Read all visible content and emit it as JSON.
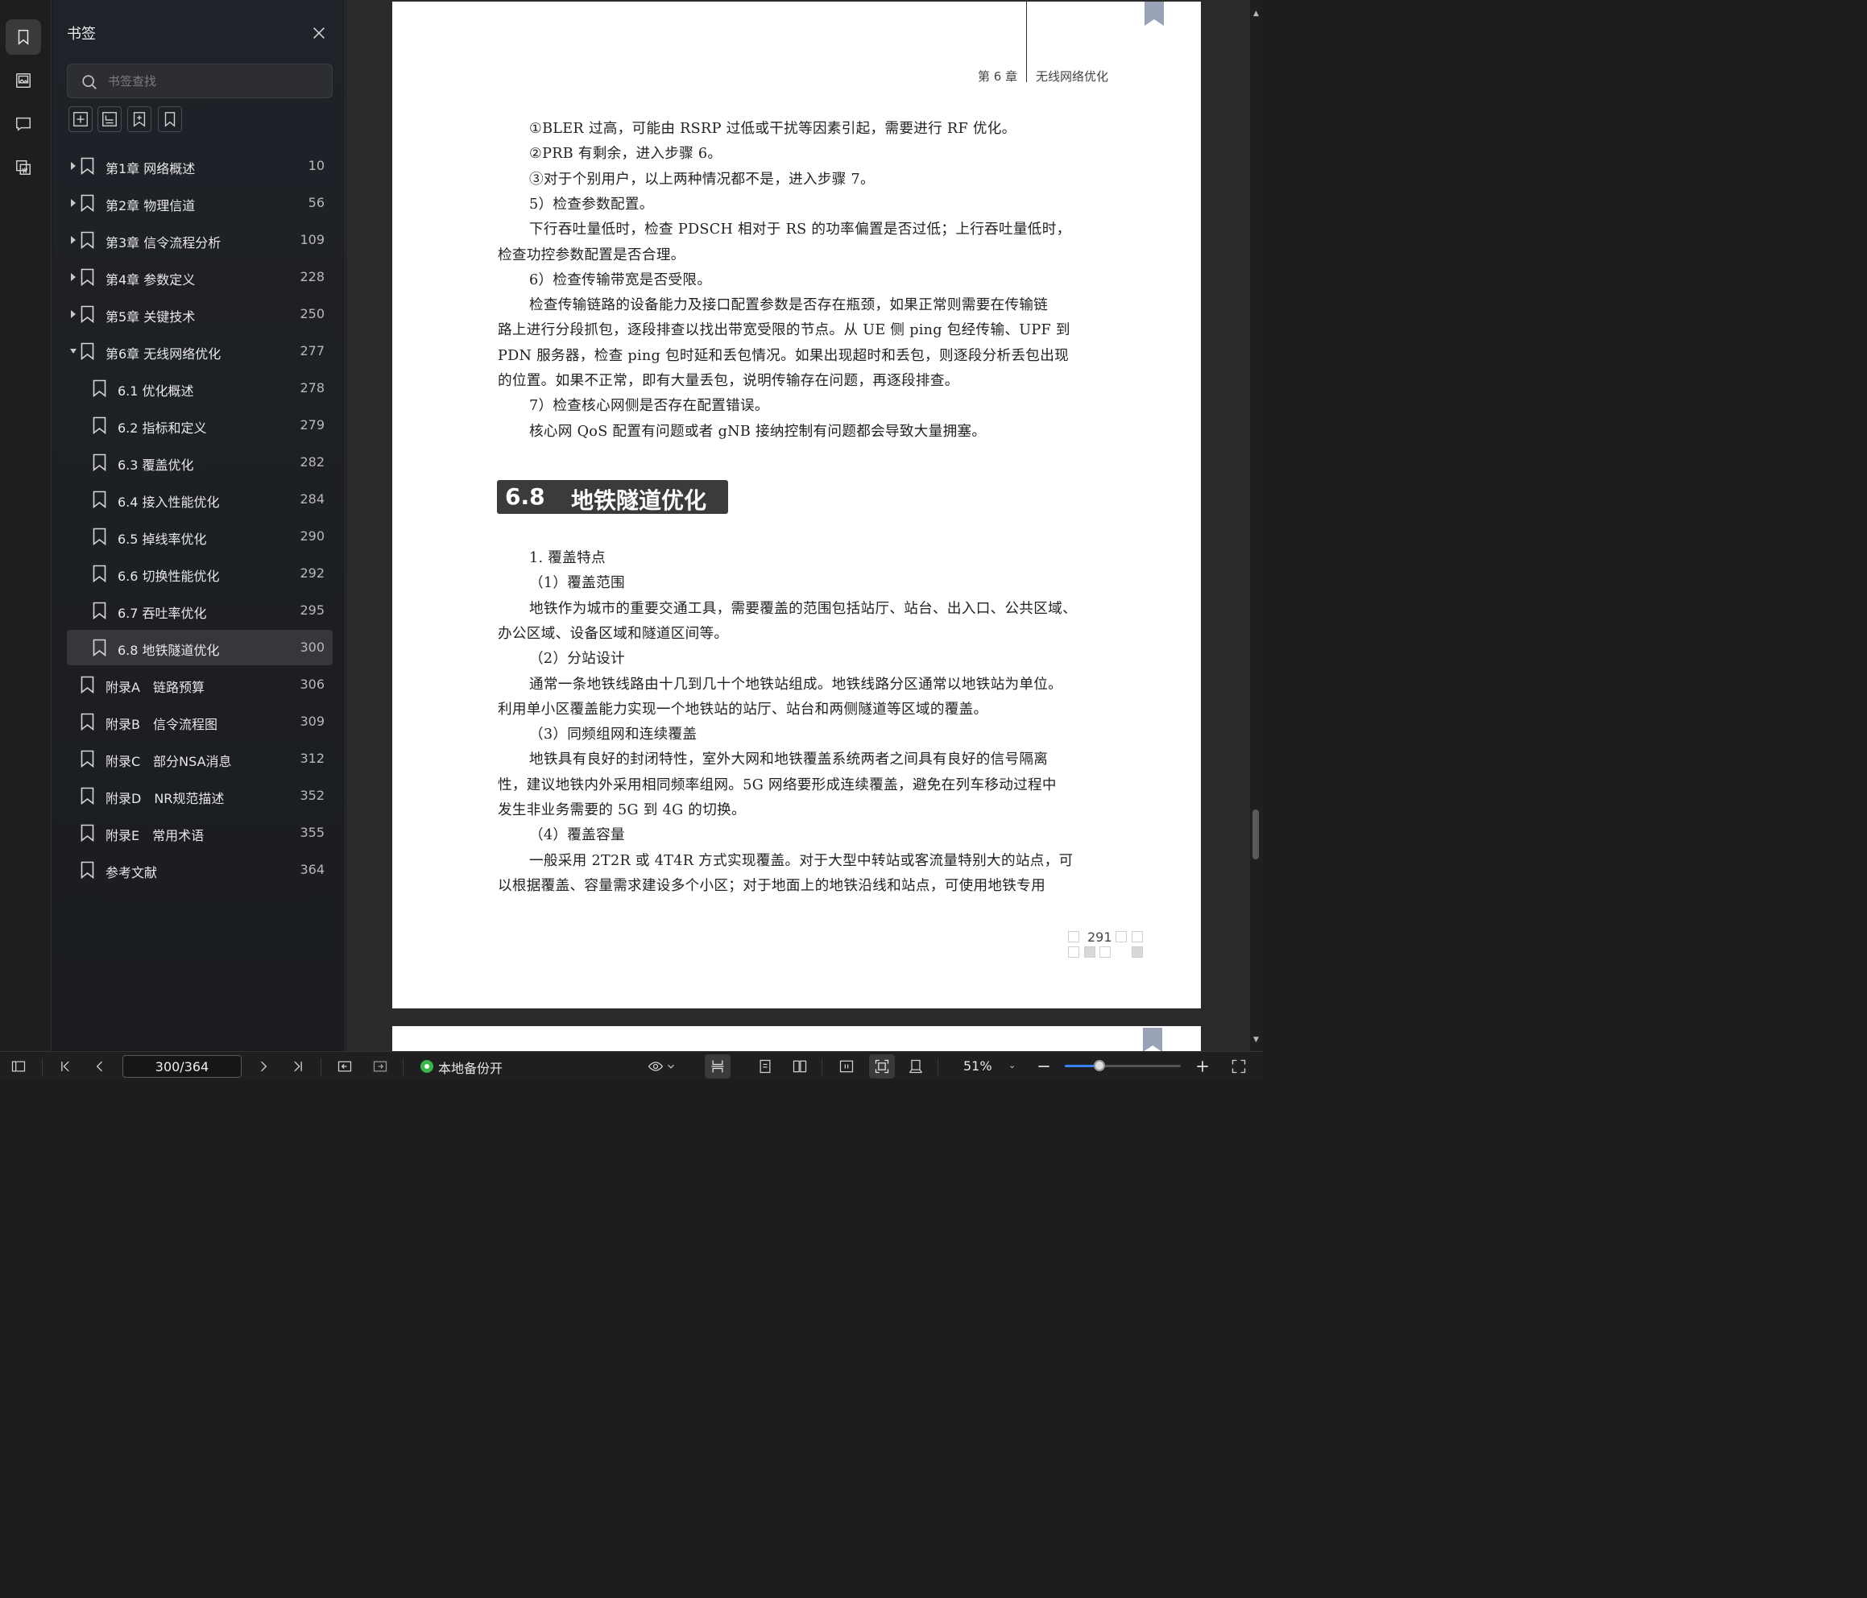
{
  "sidebar": {
    "title": "书签",
    "search_placeholder": "书签查找",
    "items": [
      {
        "label": "第1章 网络概述",
        "page": "10",
        "level": 0,
        "expandable": true,
        "expanded": false
      },
      {
        "label": "第2章 物理信道",
        "page": "56",
        "level": 0,
        "expandable": true,
        "expanded": false
      },
      {
        "label": "第3章 信令流程分析",
        "page": "109",
        "level": 0,
        "expandable": true,
        "expanded": false
      },
      {
        "label": "第4章 参数定义",
        "page": "228",
        "level": 0,
        "expandable": true,
        "expanded": false
      },
      {
        "label": "第5章 关键技术",
        "page": "250",
        "level": 0,
        "expandable": true,
        "expanded": false
      },
      {
        "label": "第6章 无线网络优化",
        "page": "277",
        "level": 0,
        "expandable": true,
        "expanded": true
      },
      {
        "label": "6.1 优化概述",
        "page": "278",
        "level": 1,
        "expandable": false
      },
      {
        "label": "6.2 指标和定义",
        "page": "279",
        "level": 1,
        "expandable": false
      },
      {
        "label": "6.3 覆盖优化",
        "page": "282",
        "level": 1,
        "expandable": false
      },
      {
        "label": "6.4 接入性能优化",
        "page": "284",
        "level": 1,
        "expandable": false
      },
      {
        "label": "6.5 掉线率优化",
        "page": "290",
        "level": 1,
        "expandable": false
      },
      {
        "label": "6.6 切换性能优化",
        "page": "292",
        "level": 1,
        "expandable": false
      },
      {
        "label": "6.7 吞吐率优化",
        "page": "295",
        "level": 1,
        "expandable": false
      },
      {
        "label": "6.8 地铁隧道优化",
        "page": "300",
        "level": 1,
        "expandable": false,
        "selected": true
      },
      {
        "label": "附录A　链路预算",
        "page": "306",
        "level": 0,
        "expandable": false
      },
      {
        "label": "附录B　信令流程图",
        "page": "309",
        "level": 0,
        "expandable": false
      },
      {
        "label": "附录C　部分NSA消息",
        "page": "312",
        "level": 0,
        "expandable": false
      },
      {
        "label": "附录D　NR规范描述",
        "page": "352",
        "level": 0,
        "expandable": false
      },
      {
        "label": "附录E　常用术语",
        "page": "355",
        "level": 0,
        "expandable": false
      },
      {
        "label": "参考文献",
        "page": "364",
        "level": 0,
        "expandable": false
      }
    ]
  },
  "document": {
    "header_chapter": "第 6 章",
    "header_title": "无线网络优化",
    "section_number": "6.8",
    "section_title": "地铁隧道优化",
    "page_number": "291",
    "lines_top": [
      {
        "text": "①BLER 过高，可能由 RSRP 过低或干扰等因素引起，需要进行 RF 优化。",
        "indent": true
      },
      {
        "text": "②PRB 有剩余，进入步骤 6。",
        "indent": true
      },
      {
        "text": "③对于个别用户，以上两种情况都不是，进入步骤 7。",
        "indent": true
      },
      {
        "text": "5）检查参数配置。",
        "indent": true
      },
      {
        "text": "下行吞吐量低时，检查 PDSCH 相对于 RS 的功率偏置是否过低；上行吞吐量低时，",
        "indent": true
      },
      {
        "text": "检查功控参数配置是否合理。",
        "indent": false
      },
      {
        "text": "6）检查传输带宽是否受限。",
        "indent": true
      },
      {
        "text": "检查传输链路的设备能力及接口配置参数是否存在瓶颈，如果正常则需要在传输链",
        "indent": true
      },
      {
        "text": "路上进行分段抓包，逐段排查以找出带宽受限的节点。从 UE 侧 ping 包经传输、UPF 到",
        "indent": false
      },
      {
        "text": "PDN 服务器，检查 ping 包时延和丢包情况。如果出现超时和丢包，则逐段分析丢包出现",
        "indent": false
      },
      {
        "text": "的位置。如果不正常，即有大量丢包，说明传输存在问题，再逐段排查。",
        "indent": false
      },
      {
        "text": "7）检查核心网侧是否存在配置错误。",
        "indent": true
      },
      {
        "text": "核心网 QoS 配置有问题或者 gNB 接纳控制有问题都会导致大量拥塞。",
        "indent": true
      }
    ],
    "lines_bottom": [
      {
        "text": "1. 覆盖特点",
        "indent": true
      },
      {
        "text": "（1）覆盖范围",
        "indent": true
      },
      {
        "text": "地铁作为城市的重要交通工具，需要覆盖的范围包括站厅、站台、出入口、公共区域、",
        "indent": true
      },
      {
        "text": "办公区域、设备区域和隧道区间等。",
        "indent": false
      },
      {
        "text": "（2）分站设计",
        "indent": true
      },
      {
        "text": "通常一条地铁线路由十几到几十个地铁站组成。地铁线路分区通常以地铁站为单位。",
        "indent": true
      },
      {
        "text": "利用单小区覆盖能力实现一个地铁站的站厅、站台和两侧隧道等区域的覆盖。",
        "indent": false
      },
      {
        "text": "（3）同频组网和连续覆盖",
        "indent": true
      },
      {
        "text": "地铁具有良好的封闭特性，室外大网和地铁覆盖系统两者之间具有良好的信号隔离",
        "indent": true
      },
      {
        "text": "性，建议地铁内外采用相同频率组网。5G 网络要形成连续覆盖，避免在列车移动过程中",
        "indent": false
      },
      {
        "text": "发生非业务需要的 5G 到 4G 的切换。",
        "indent": false
      },
      {
        "text": "（4）覆盖容量",
        "indent": true
      },
      {
        "text": "一般采用 2T2R 或 4T4R 方式实现覆盖。对于大型中转站或客流量特别大的站点，可",
        "indent": true
      },
      {
        "text": "以根据覆盖、容量需求建设多个小区；对于地面上的地铁沿线和站点，可使用地铁专用",
        "indent": false
      }
    ]
  },
  "toolbar": {
    "page_value": "300/364",
    "backup_label": "本地备份开",
    "zoom_label": "51%",
    "zoom_level_percent": 30
  },
  "colors": {
    "accent": "#3b82f6",
    "backup_green": "#3bb54a",
    "section_box": "#3b3b3b",
    "ribbon": "#9aa2b8"
  }
}
